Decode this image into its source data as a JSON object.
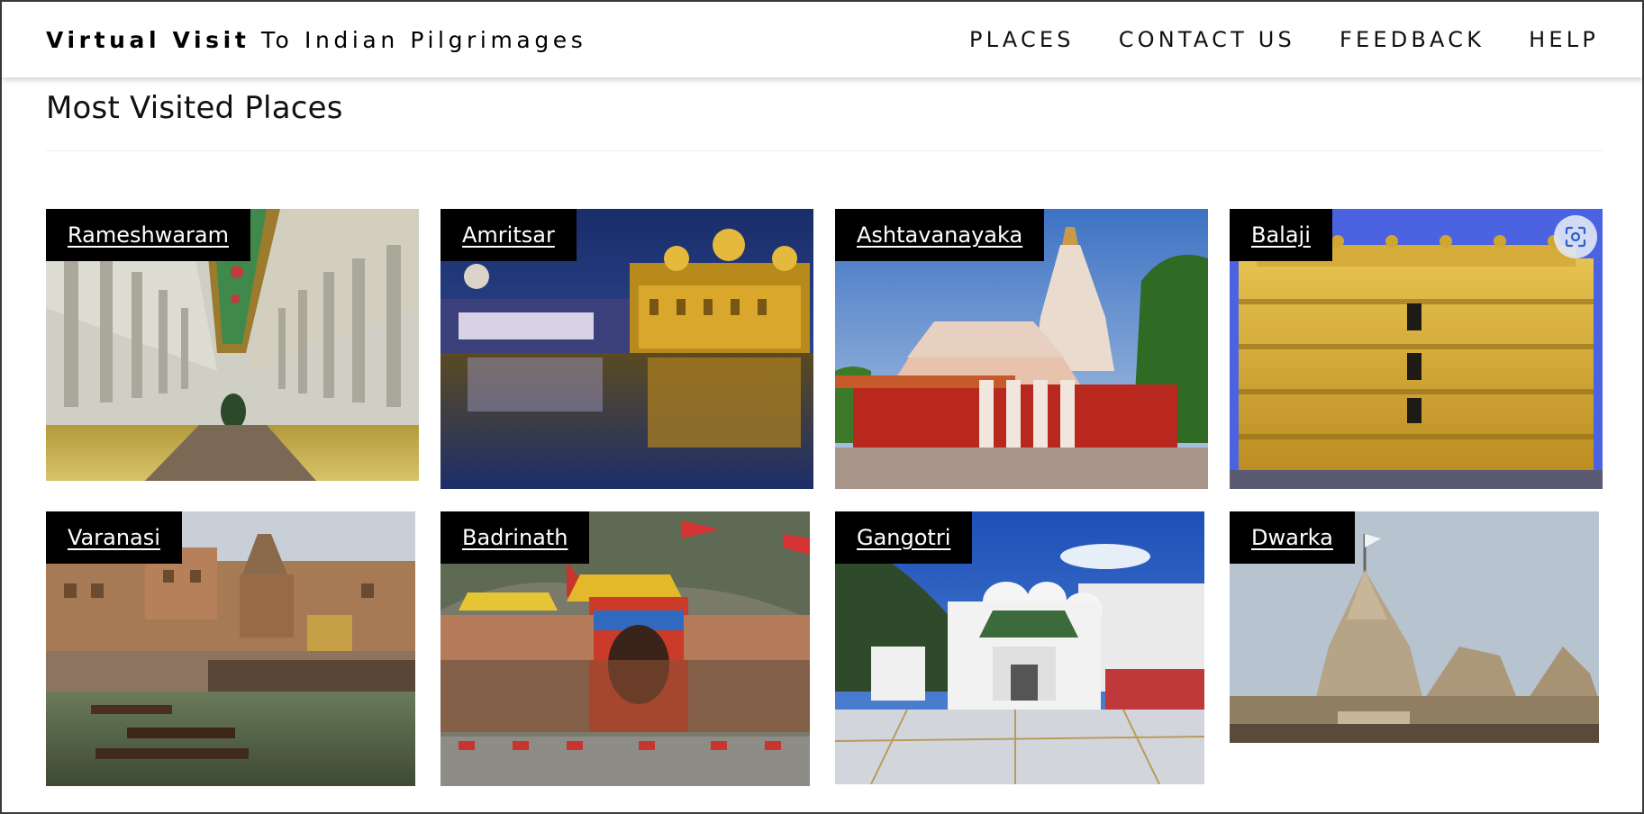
{
  "brand": {
    "bold": "Virtual Visit",
    "rest": "To Indian Pilgrimages"
  },
  "nav": [
    {
      "label": "PLACES"
    },
    {
      "label": "CONTACT US"
    },
    {
      "label": "FEEDBACK"
    },
    {
      "label": "HELP"
    }
  ],
  "section": {
    "title": "Most Visited Places"
  },
  "places": [
    {
      "name": "Rameshwaram"
    },
    {
      "name": "Amritsar"
    },
    {
      "name": "Ashtavanayaka"
    },
    {
      "name": "Balaji"
    },
    {
      "name": "Varanasi"
    },
    {
      "name": "Badrinath"
    },
    {
      "name": "Gangotri"
    },
    {
      "name": "Dwarka"
    }
  ],
  "icons": {
    "visual_search": "lens-scan-icon"
  }
}
